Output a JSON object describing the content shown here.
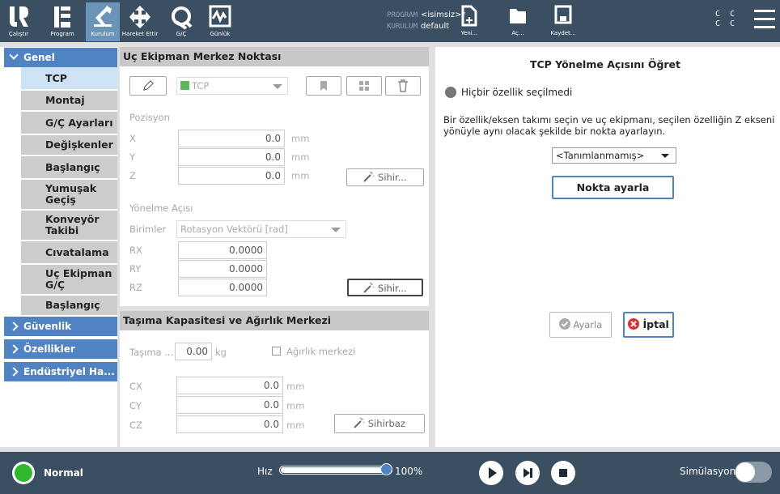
{
  "topbar": {
    "nav": [
      {
        "label": "Çalıştır",
        "icon": "ur-logo-icon"
      },
      {
        "label": "Program",
        "icon": "program-icon"
      },
      {
        "label": "Kurulum",
        "icon": "robot-arm-icon"
      },
      {
        "label": "Hareket Ettir",
        "icon": "move-arrows-icon"
      },
      {
        "label": "G/Ç",
        "icon": "io-icon"
      },
      {
        "label": "Günlük",
        "icon": "log-icon"
      }
    ],
    "program_key": "PROGRAM",
    "program_value": "<isimsiz>*",
    "install_key": "KURULUM",
    "install_value": "default",
    "file_buttons": [
      {
        "label": "Yeni...",
        "icon": "new-file-icon"
      },
      {
        "label": "Aç...",
        "icon": "folder-icon"
      },
      {
        "label": "Kaydet...",
        "icon": "save-icon"
      }
    ],
    "cc": "C C",
    "cc2": "C C"
  },
  "leftnav": {
    "sections": [
      "Genel",
      "Güvenlik",
      "Özellikler",
      "Endüstriyel Ha..."
    ],
    "items": [
      "TCP",
      "Montaj",
      "G/Ç Ayarları",
      "Değişkenler",
      "Başlangıç",
      "Yumuşak Geçiş",
      "Konveyör Takibi",
      "Cıvatalama",
      "Uç Ekipman G/Ç",
      "Başlangıç"
    ]
  },
  "tcp": {
    "title": "Uç Ekipman Merkez Noktası",
    "selected_tcp": "TCP",
    "position_label": "Pozisyon",
    "x_label": "X",
    "x_value": "0.0",
    "y_label": "Y",
    "y_value": "0.0",
    "z_label": "Z",
    "z_value": "0.0",
    "unit_mm": "mm",
    "wizard_label": "Sihir...",
    "orientation_label": "Yönelme Açısı",
    "units_label": "Birimler",
    "units_value": "Rotasyon Vektörü [rad]",
    "rx_label": "RX",
    "rx_value": "0.0000",
    "ry_label": "RY",
    "ry_value": "0.0000",
    "rz_label": "RZ",
    "rz_value": "0.0000",
    "wizard2_label": "Sihir..."
  },
  "payload": {
    "title": "Taşıma Kapasitesi ve Ağırlık Merkezi",
    "payload_label": "Taşıma ...",
    "payload_value": "0.00",
    "unit_kg": "kg",
    "cog_label": "Ağırlık merkezi",
    "cx_label": "CX",
    "cx_value": "0.0",
    "cy_label": "CY",
    "cy_value": "0.0",
    "cz_label": "CZ",
    "cz_value": "0.0",
    "unit_mm": "mm",
    "wizard_label": "Sihirbaz"
  },
  "right": {
    "title": "TCP Yönelme Açısını Öğret",
    "status": "Hiçbir özellik seçilmedi",
    "instruction": "Bir özellik/eksen takımı seçin ve uç ekipmanı, seçilen özelliğin Z ekseni yönüyle aynı olacak şekilde bir nokta ayarlayın.",
    "feature_select": "<Tanımlanmamış>",
    "set_point_label": "Nokta ayarla",
    "apply_label": "Ayarla",
    "cancel_label": "İptal"
  },
  "bottombar": {
    "status": "Normal",
    "speed_label": "Hız",
    "speed_value": "100%",
    "speed_fraction": 1.0,
    "simulation_label": "Simülasyon"
  }
}
